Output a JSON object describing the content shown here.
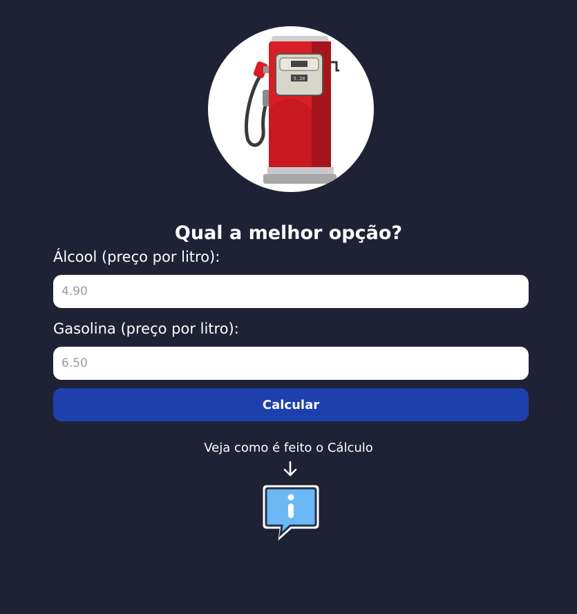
{
  "header": {
    "image": "fuel-pump-icon"
  },
  "form": {
    "title": "Qual a melhor opção?",
    "alcool": {
      "label": "Álcool (preço por litro):",
      "placeholder": "4.90",
      "value": ""
    },
    "gasolina": {
      "label": "Gasolina (preço por litro):",
      "placeholder": "6.50",
      "value": ""
    },
    "submit_label": "Calcular"
  },
  "info": {
    "text": "Veja como é feito o Cálculo",
    "arrow_icon": "arrow-down-icon",
    "icon": "info-speech-bubble-icon"
  },
  "colors": {
    "background": "#1f2135",
    "button": "#1e40ad",
    "input_background": "#ffffff",
    "pump_red": "#d81e25",
    "info_blue": "#6cb8f4"
  }
}
